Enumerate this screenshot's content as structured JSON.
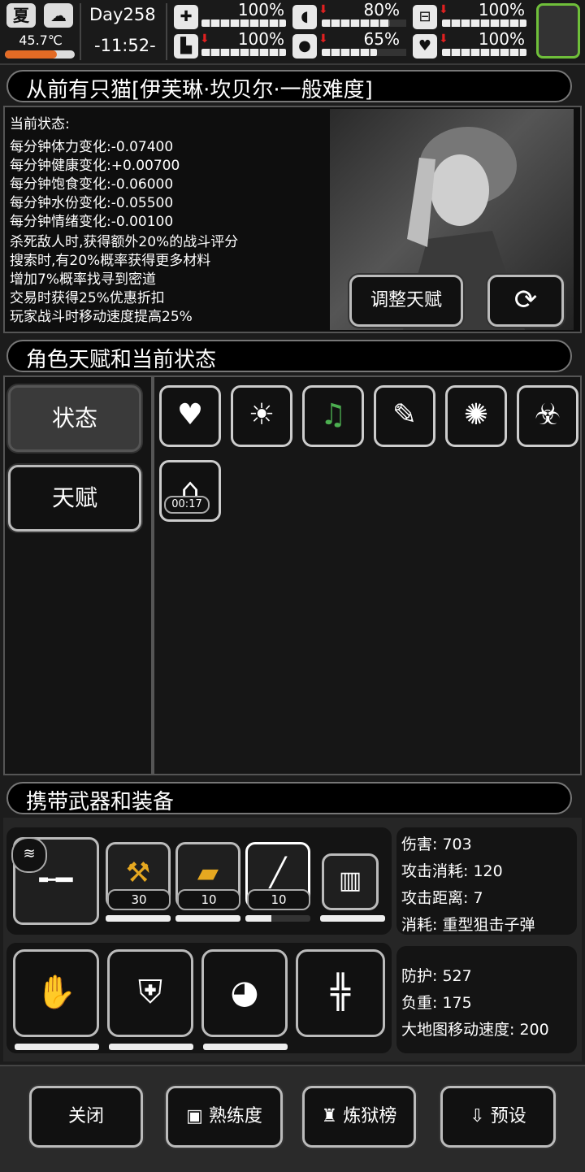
{
  "topbar": {
    "season": "夏",
    "weather_icon": "cloud-icon",
    "temperature": "45.7℃",
    "temperature_level": 0.75,
    "day": "Day258",
    "clock": "-11:52-",
    "stats": [
      {
        "icon": "medkit-icon",
        "glyph": "✚",
        "value": "100%",
        "fill": 1.0,
        "falling": false
      },
      {
        "icon": "stomach-icon",
        "glyph": "◖",
        "value": "80%",
        "fill": 0.8,
        "falling": true
      },
      {
        "icon": "pill-icon",
        "glyph": "⊟",
        "value": "100%",
        "fill": 1.0,
        "falling": true
      },
      {
        "icon": "boot-icon",
        "glyph": "▙",
        "value": "100%",
        "fill": 1.0,
        "falling": true
      },
      {
        "icon": "water-drop-icon",
        "glyph": "💧",
        "value": "65%",
        "fill": 0.65,
        "falling": true
      },
      {
        "icon": "heart-icon",
        "glyph": "♥",
        "value": "100%",
        "fill": 1.0,
        "falling": true
      }
    ],
    "accent_color": "#6fbf3a"
  },
  "character": {
    "title": "从前有只猫[伊芙琳·坎贝尔·一般难度]",
    "status_header": "当前状态:",
    "status_lines": [
      "每分钟体力变化:-0.07400",
      "每分钟健康变化:+0.00700",
      "每分钟饱食变化:-0.06000",
      "每分钟水份变化:-0.05500",
      "每分钟情绪变化:-0.00100",
      "杀死敌人时,获得额外20%的战斗评分",
      "搜索时,有20%概率获得更多材料",
      "增加7%概率找寻到密道",
      "交易时获得25%优惠折扣",
      "玩家战斗时移动速度提高25%"
    ],
    "adjust_talent_button": "调整天赋",
    "swap_outfit_icon": "outfit-swap-icon"
  },
  "talents": {
    "title": "角色天赋和当前状态",
    "tabs": [
      {
        "label": "状态",
        "active": true
      },
      {
        "label": "天赋",
        "active": false
      }
    ],
    "status_icons": [
      {
        "name": "heart-icon",
        "glyph": "♥"
      },
      {
        "name": "sun-icon",
        "glyph": "☀"
      },
      {
        "name": "music-heart-icon",
        "glyph": "♫"
      },
      {
        "name": "medical-report-icon",
        "glyph": "📋"
      },
      {
        "name": "alarm-light-icon",
        "glyph": "🚨"
      },
      {
        "name": "nausea-stomach-icon",
        "glyph": "☣"
      }
    ],
    "timer_icon": {
      "name": "shelter-question-icon",
      "glyph": "⌂",
      "timer": "00:17"
    }
  },
  "equipment": {
    "title": "携带武器和装备",
    "weapon_stats": [
      {
        "label": "伤害",
        "value": "703"
      },
      {
        "label": "攻击消耗",
        "value": "120"
      },
      {
        "label": "攻击距离",
        "value": "7"
      },
      {
        "label": "消耗",
        "value": "重型狙击子弹"
      }
    ],
    "armor_stats": [
      {
        "label": "防护",
        "value": "527"
      },
      {
        "label": "负重",
        "value": "175"
      },
      {
        "label": "大地图移动速度",
        "value": "200"
      }
    ],
    "weapons": [
      {
        "name": "sniper-rifle-icon",
        "ammo": ""
      },
      {
        "name": "golden-hammer-icon",
        "ammo": "30"
      },
      {
        "name": "golden-rifle-icon",
        "ammo": "10"
      },
      {
        "name": "assault-rifle-icon",
        "ammo": "10"
      },
      {
        "name": "battery-pack-icon",
        "ammo": ""
      }
    ],
    "armor": [
      {
        "name": "gloves-icon"
      },
      {
        "name": "body-armor-icon"
      },
      {
        "name": "helmet-icon"
      },
      {
        "name": "exoskeleton-icon"
      }
    ]
  },
  "footer": {
    "close": "关闭",
    "proficiency": "熟练度",
    "ranking": "炼狱榜",
    "preset": "预设"
  }
}
